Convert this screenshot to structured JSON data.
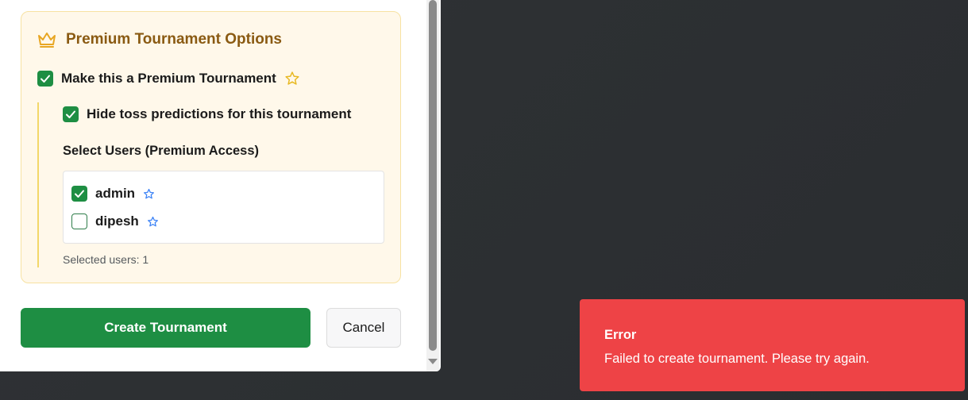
{
  "premium": {
    "title": "Premium Tournament Options",
    "make_premium_label": "Make this a Premium Tournament",
    "make_premium_checked": true,
    "hide_toss_label": "Hide toss predictions for this tournament",
    "hide_toss_checked": true,
    "select_users_label": "Select Users (Premium Access)",
    "users": [
      {
        "name": "admin",
        "checked": true
      },
      {
        "name": "dipesh",
        "checked": false
      }
    ],
    "selected_count_text": "Selected users: 1"
  },
  "actions": {
    "create_label": "Create Tournament",
    "cancel_label": "Cancel"
  },
  "toast": {
    "title": "Error",
    "message": "Failed to create tournament. Please try again."
  },
  "colors": {
    "green": "#1e8e43",
    "gold": "#8a5a12",
    "card_bg": "#fff8ea",
    "toast_bg": "#ee4346",
    "star_blue": "#3b82f6",
    "star_gold": "#e8b923"
  },
  "icons": {
    "crown": "crown-icon",
    "star": "star-icon",
    "check": "check-icon"
  }
}
